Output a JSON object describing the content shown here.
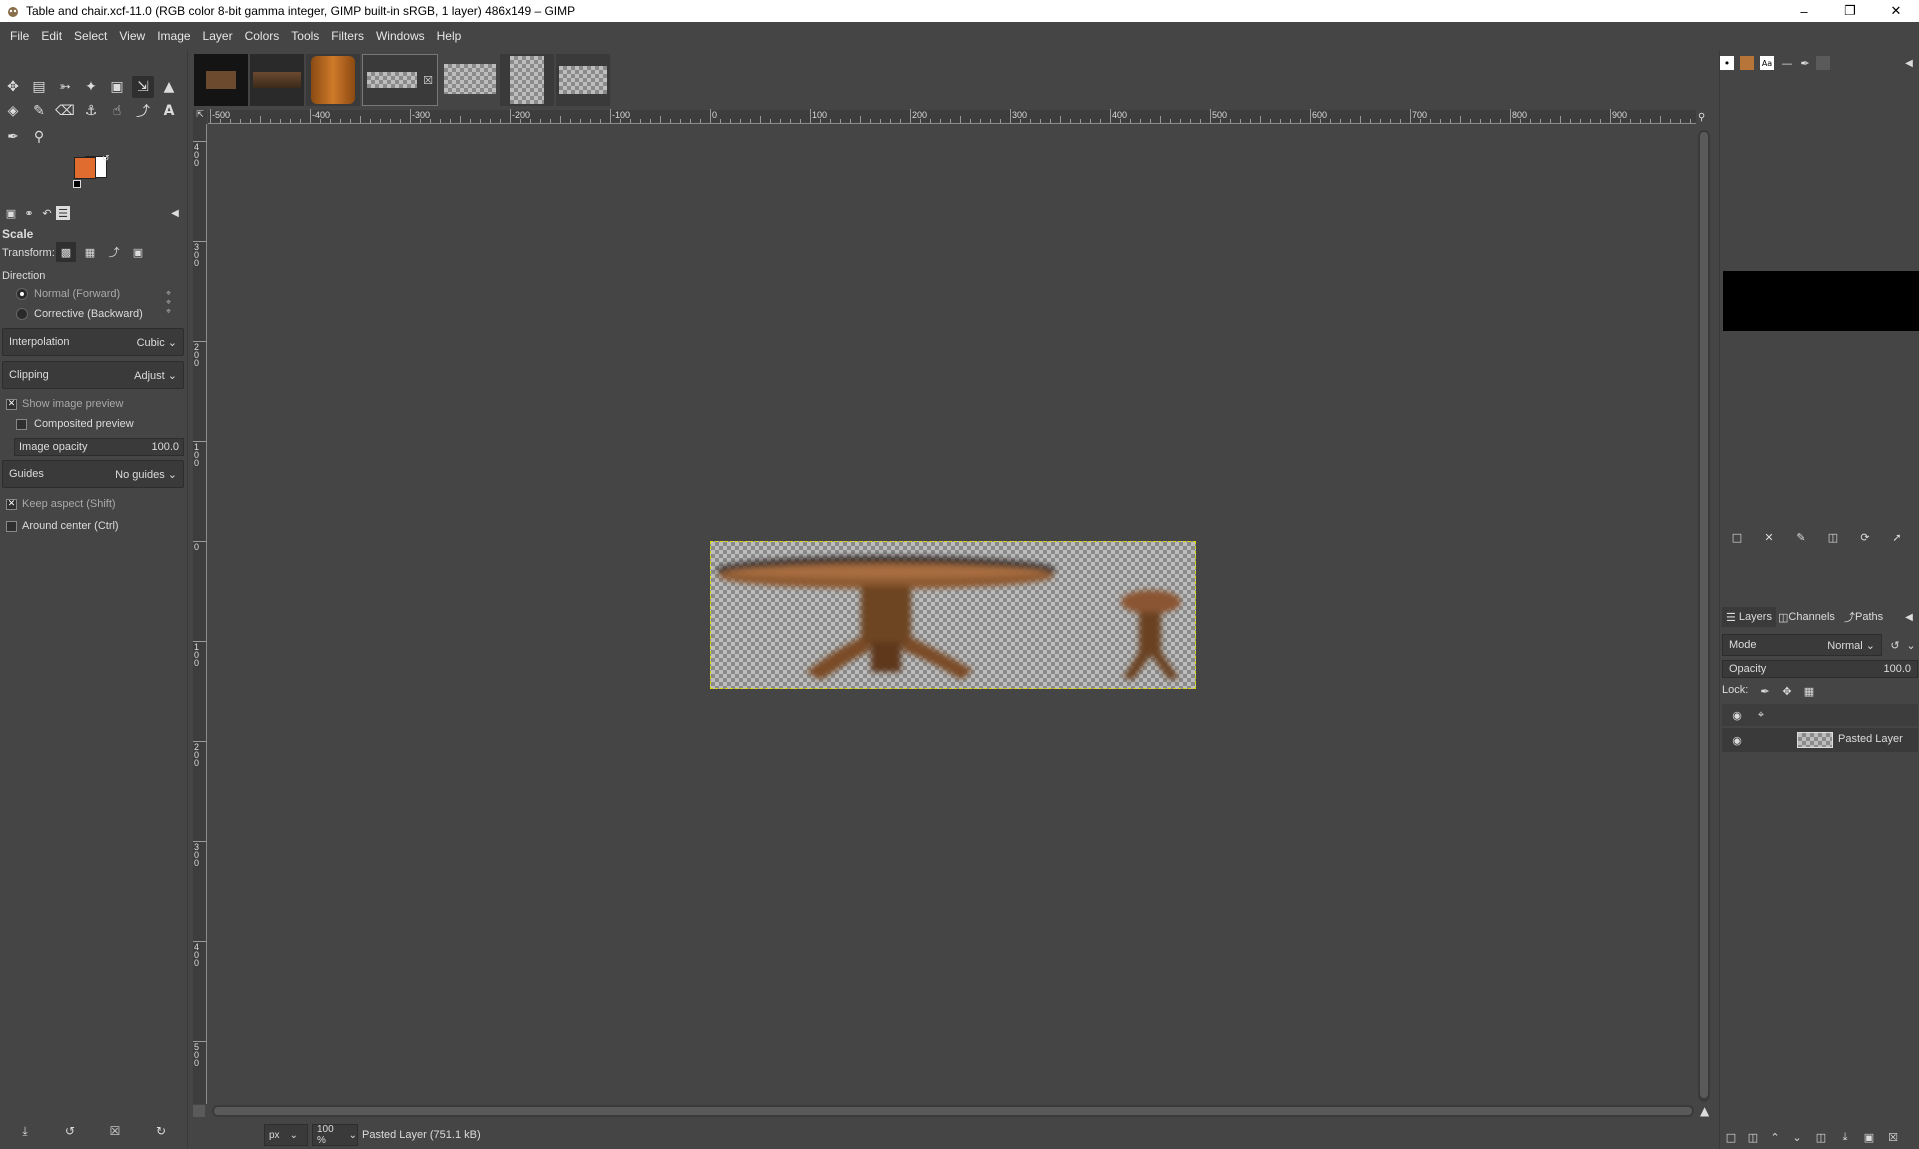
{
  "window": {
    "title": "Table and chair.xcf-11.0 (RGB color 8-bit gamma integer, GIMP built-in sRGB, 1 layer) 486x149 – GIMP",
    "minimize": "–",
    "maximize": "❐",
    "close": "✕"
  },
  "menu": [
    "File",
    "Edit",
    "Select",
    "View",
    "Image",
    "Layer",
    "Colors",
    "Tools",
    "Filters",
    "Windows",
    "Help"
  ],
  "colors": {
    "foreground": "#e06c30",
    "background": "#ffffff",
    "selection_border": "#d8d800"
  },
  "tool_options": {
    "title": "Scale",
    "transform_label": "Transform:",
    "direction_label": "Direction",
    "direction_normal": "Normal (Forward)",
    "direction_corrective": "Corrective (Backward)",
    "interpolation_label": "Interpolation",
    "interpolation_value": "Cubic",
    "clipping_label": "Clipping",
    "clipping_value": "Adjust",
    "show_preview": "Show image preview",
    "composited_preview": "Composited preview",
    "image_opacity_label": "Image opacity",
    "image_opacity_value": "100.0",
    "guides_label": "Guides",
    "guides_value": "No guides",
    "keep_aspect": "Keep aspect (Shift)",
    "around_center": "Around center (Ctrl)"
  },
  "rulers": {
    "h_labels": [
      "-500",
      "-400",
      "-300",
      "-200",
      "-100",
      "0",
      "100",
      "200",
      "300",
      "400",
      "500",
      "600",
      "700",
      "800",
      "900"
    ],
    "v_labels": [
      "400",
      "300",
      "200",
      "100",
      "0",
      "100",
      "200",
      "300",
      "400",
      "500"
    ]
  },
  "status": {
    "unit": "px",
    "zoom": "100 %",
    "message": "Pasted Layer (751.1 kB)"
  },
  "layers_panel": {
    "tabs": [
      "Layers",
      "Channels",
      "Paths"
    ],
    "mode_label": "Mode",
    "mode_value": "Normal",
    "opacity_label": "Opacity",
    "opacity_value": "100.0",
    "lock_label": "Lock:",
    "layer_name": "Pasted Layer"
  },
  "icons": {
    "chevron": "⌄",
    "eye": "👁",
    "checkmark": "✕"
  }
}
